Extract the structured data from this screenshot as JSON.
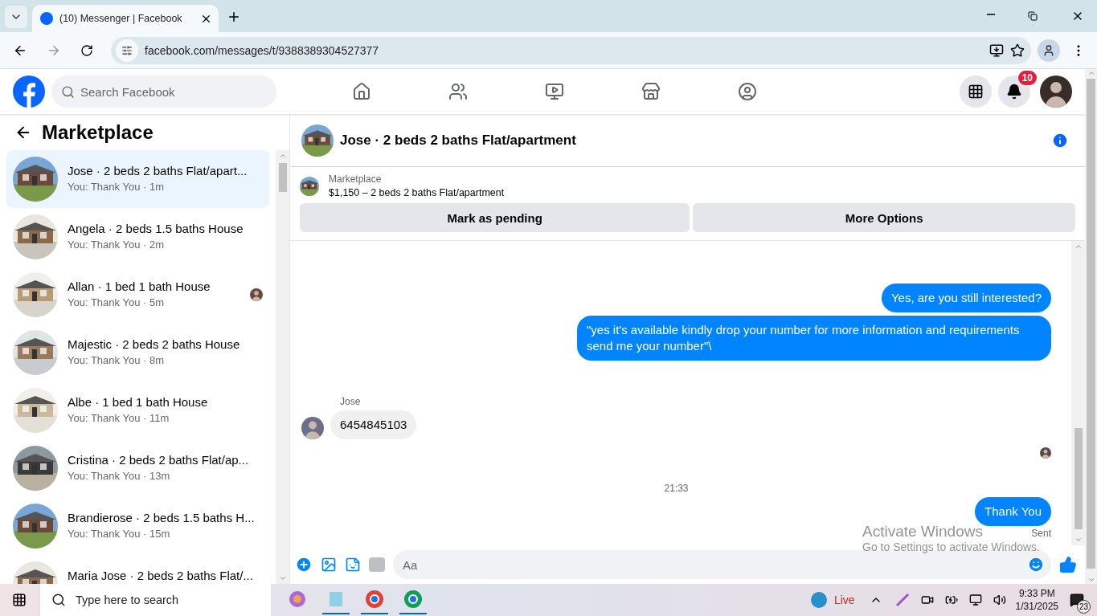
{
  "browser": {
    "tabs": [
      {
        "title": "(10) Messenger | Facebook",
        "selected": true
      }
    ],
    "url": "facebook.com/messages/t/9388389304527377"
  },
  "topbar": {
    "search": {
      "placeholder": "Search Facebook"
    },
    "notification_count": "10"
  },
  "sidebar": {
    "title": "Marketplace",
    "conversations": [
      {
        "title": "Jose · 2 beds 2 baths Flat/apart...",
        "subtitle": "You: Thank You · 1m",
        "selected": true,
        "seen": false
      },
      {
        "title": "Angela · 2 beds 1.5 baths House",
        "subtitle": "You: Thank You · 2m",
        "selected": false,
        "seen": false
      },
      {
        "title": "Allan · 1 bed 1 bath House",
        "subtitle": "You: Thank You · 5m",
        "selected": false,
        "seen": true
      },
      {
        "title": "Majestic · 2 beds 2 baths House",
        "subtitle": "You: Thank You · 8m",
        "selected": false,
        "seen": false
      },
      {
        "title": "Albe · 1 bed 1 bath House",
        "subtitle": "You: Thank You · 11m",
        "selected": false,
        "seen": false
      },
      {
        "title": "Cristina · 2 beds 2 baths Flat/ap...",
        "subtitle": "You: Thank You · 13m",
        "selected": false,
        "seen": false
      },
      {
        "title": "Brandierose · 2 beds 1.5 baths H...",
        "subtitle": "You: Thank You · 15m",
        "selected": false,
        "seen": false
      },
      {
        "title": "Maria Jose · 2 beds 2 baths Flat/...",
        "selected": false,
        "seen": false
      }
    ]
  },
  "chat": {
    "title": "Jose · 2 beds 2 baths Flat/apartment",
    "listing": {
      "label": "Marketplace",
      "detail": "$1,150 – 2 beds 2 baths Flat/apartment"
    },
    "buttons": [
      "Mark as pending",
      "More Options"
    ],
    "messages": [
      {
        "kind": "outgoing",
        "text": "Yes, are you still interested?"
      },
      {
        "kind": "outgoing",
        "text": "\"yes it's available kindly drop your number for more information and requirements send me your number\"\\"
      },
      {
        "kind": "incoming",
        "sender": "Jose",
        "text": "6454845103"
      },
      {
        "kind": "seen"
      },
      {
        "kind": "time",
        "text": "21:33"
      },
      {
        "kind": "outgoing",
        "text": "Thank You",
        "status": "Sent"
      }
    ],
    "composer": {
      "placeholder": "Aa"
    }
  },
  "activation_notice": {
    "title": "Activate Windows",
    "subtitle": "Go to Settings to activate Windows."
  },
  "taskbar": {
    "search": {
      "placeholder": "Type here to search"
    },
    "weather": "Live",
    "time": "9:33 PM",
    "date": "1/31/2025",
    "notifications": "23"
  }
}
